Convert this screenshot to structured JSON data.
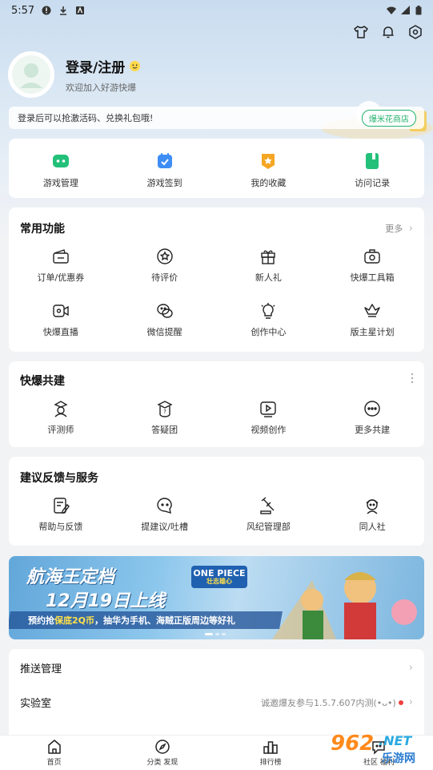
{
  "status_bar": {
    "time": "5:57",
    "battery_icon": "battery-icon",
    "wifi_icon": "wifi-icon"
  },
  "header_icons": [
    "tshirt-icon",
    "bell-icon",
    "settings-hex-icon"
  ],
  "profile": {
    "title": "登录/注册",
    "subtitle": "欢迎加入好游快爆"
  },
  "notice": {
    "text": "登录后可以抢激活码、兑换礼包哦!",
    "button": "爆米花商店"
  },
  "quick": [
    {
      "label": "游戏管理",
      "icon": "gamepad-icon",
      "color": "#23c07a"
    },
    {
      "label": "游戏签到",
      "icon": "calendar-check-icon",
      "color": "#3d8df5"
    },
    {
      "label": "我的收藏",
      "icon": "star-badge-icon",
      "color": "#f5a623"
    },
    {
      "label": "访问记录",
      "icon": "book-icon",
      "color": "#23c07a"
    }
  ],
  "common": {
    "title": "常用功能",
    "more": "更多",
    "items": [
      {
        "label": "订单/优惠券",
        "icon": "wallet-icon"
      },
      {
        "label": "待评价",
        "icon": "star-bubble-icon"
      },
      {
        "label": "新人礼",
        "icon": "gift-icon"
      },
      {
        "label": "快爆工具箱",
        "icon": "toolbox-icon"
      },
      {
        "label": "快爆直播",
        "icon": "video-camera-icon"
      },
      {
        "label": "微信提醒",
        "icon": "wechat-icon"
      },
      {
        "label": "创作中心",
        "icon": "lightbulb-icon"
      },
      {
        "label": "版主星计划",
        "icon": "crown-icon"
      }
    ]
  },
  "cobuild": {
    "title": "快爆共建",
    "items": [
      {
        "label": "评测师",
        "icon": "reviewer-icon"
      },
      {
        "label": "答疑团",
        "icon": "question-cap-icon"
      },
      {
        "label": "视频创作",
        "icon": "play-video-icon"
      },
      {
        "label": "更多共建",
        "icon": "more-dots-icon"
      }
    ]
  },
  "feedback": {
    "title": "建议反馈与服务",
    "items": [
      {
        "label": "帮助与反馈",
        "icon": "help-edit-icon"
      },
      {
        "label": "提建议/吐槽",
        "icon": "chat-bubble-icon"
      },
      {
        "label": "风纪管理部",
        "icon": "gavel-icon"
      },
      {
        "label": "同人社",
        "icon": "fan-art-icon"
      }
    ]
  },
  "banner": {
    "title1": "航海王定档",
    "title2": "12月19日上线",
    "sub_a": "预约抢",
    "sub_hl": "保底2Q币",
    "sub_b": "，抽华为手机、海贼正版周边等好礼",
    "logo": "ONE PIECE",
    "logo_sub": "壮志雄心"
  },
  "list": [
    {
      "label": "推送管理",
      "extra": ""
    },
    {
      "label": "实验室",
      "extra": "诚邀爆友参与1.5.7.607内测(•ᴗ•)"
    }
  ],
  "tabs": [
    {
      "label": "首页",
      "icon": "home-icon"
    },
    {
      "label": "分类 发现",
      "icon": "compass-icon"
    },
    {
      "label": "排行榜",
      "icon": "ranking-icon"
    },
    {
      "label": "社区 福利",
      "icon": "community-icon"
    }
  ],
  "watermark": {
    "num": "962",
    "net": ".NET",
    "cn": "乐游网"
  }
}
